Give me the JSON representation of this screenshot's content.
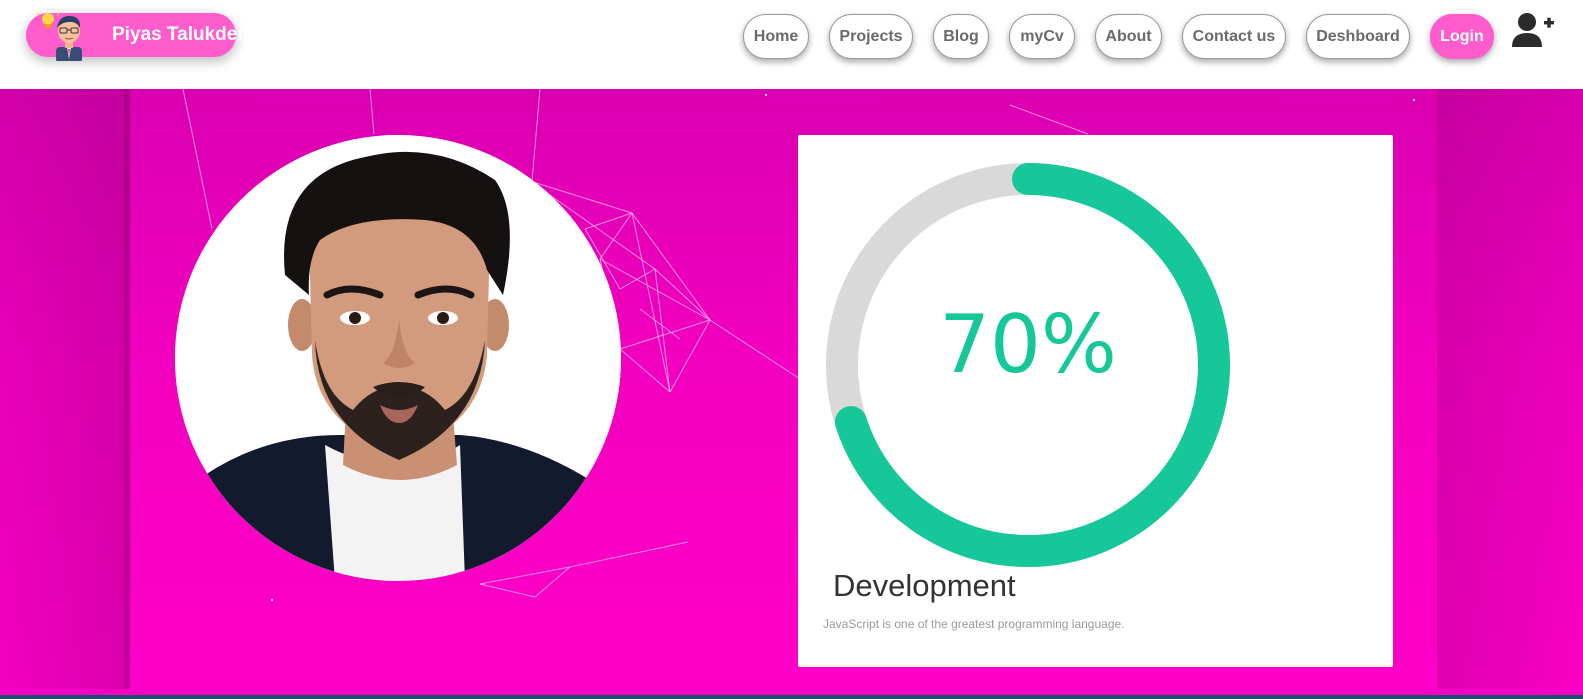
{
  "navbar": {
    "brand": {
      "name": "Piyas Talukder",
      "logo_icon": "developer-avatar-icon"
    },
    "items": [
      {
        "label": "Home"
      },
      {
        "label": "Projects"
      },
      {
        "label": "Blog"
      },
      {
        "label": "myCv"
      },
      {
        "label": "About"
      },
      {
        "label": "Contact us"
      },
      {
        "label": "Deshboard"
      },
      {
        "label": "Login"
      }
    ],
    "user_icon": "user-plus-icon"
  },
  "hero": {
    "profile_image": "profile-photo",
    "card": {
      "progress": {
        "value": 70,
        "label": "70%"
      },
      "title": "Development",
      "description": "JavaScript is one of the greatest programming language."
    }
  },
  "colors": {
    "brand_pink": "#ff5ccd",
    "hero_magenta": "#f200bf",
    "progress_green": "#16c79a",
    "progress_track": "#d9d9d9",
    "nav_text": "#6a6a6a"
  }
}
